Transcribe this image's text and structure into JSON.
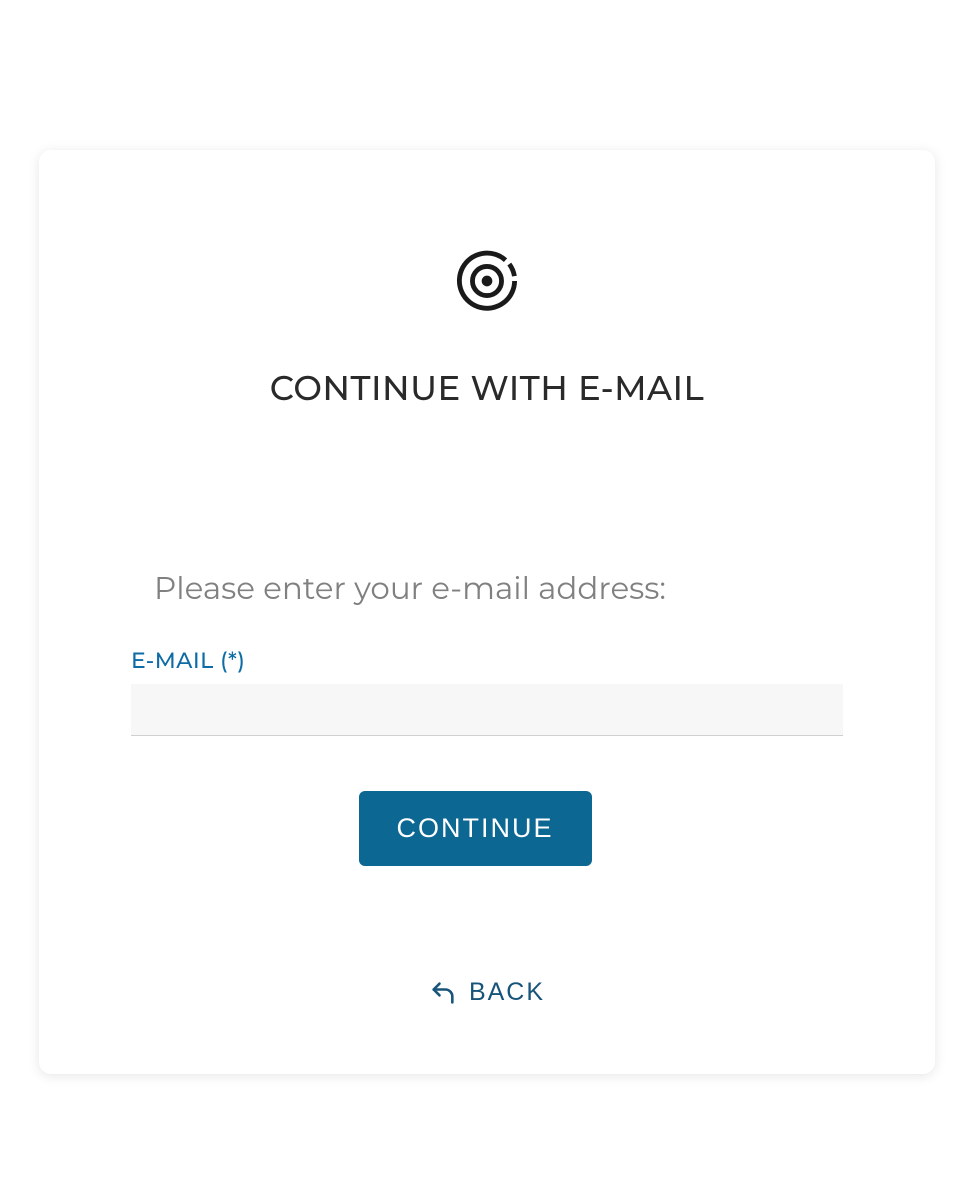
{
  "header": {
    "title": "CONTINUE WITH E-MAIL"
  },
  "form": {
    "instruction": "Please enter your e-mail address:",
    "email_label": "E-MAIL (*)",
    "email_value": ""
  },
  "actions": {
    "continue_label": "CONTINUE",
    "back_label": "BACK"
  }
}
